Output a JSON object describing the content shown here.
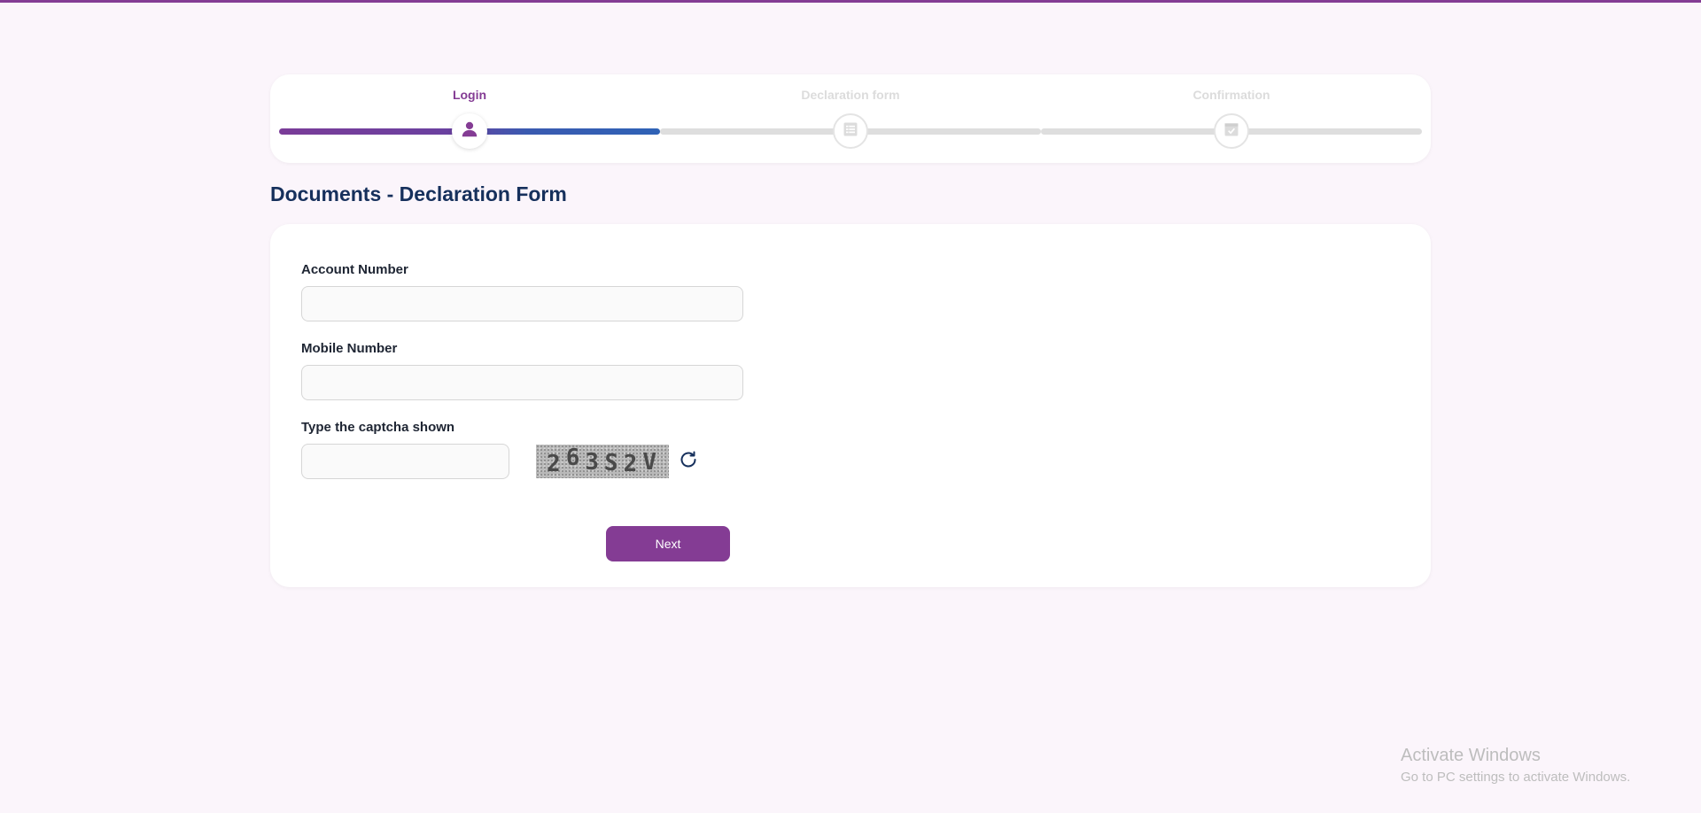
{
  "stepper": {
    "steps": [
      {
        "label": "Login",
        "icon": "user-icon",
        "state": "active"
      },
      {
        "label": "Declaration form",
        "icon": "form-list-icon",
        "state": "inactive"
      },
      {
        "label": "Confirmation",
        "icon": "calendar-check-icon",
        "state": "inactive"
      }
    ]
  },
  "page": {
    "title": "Documents - Declaration Form"
  },
  "form": {
    "account_label": "Account Number",
    "account_value": "",
    "mobile_label": "Mobile Number",
    "mobile_value": "",
    "captcha_label": "Type the captcha shown",
    "captcha_value": "",
    "captcha_chars": [
      "2",
      "6",
      "3",
      "S",
      "2",
      "V"
    ],
    "refresh_icon": "refresh-icon",
    "next_label": "Next"
  },
  "watermark": {
    "title": "Activate Windows",
    "subtitle": "Go to PC settings to activate Windows."
  },
  "colors": {
    "accent": "#843c94",
    "title": "#16305c",
    "background": "#fbf5fb"
  }
}
